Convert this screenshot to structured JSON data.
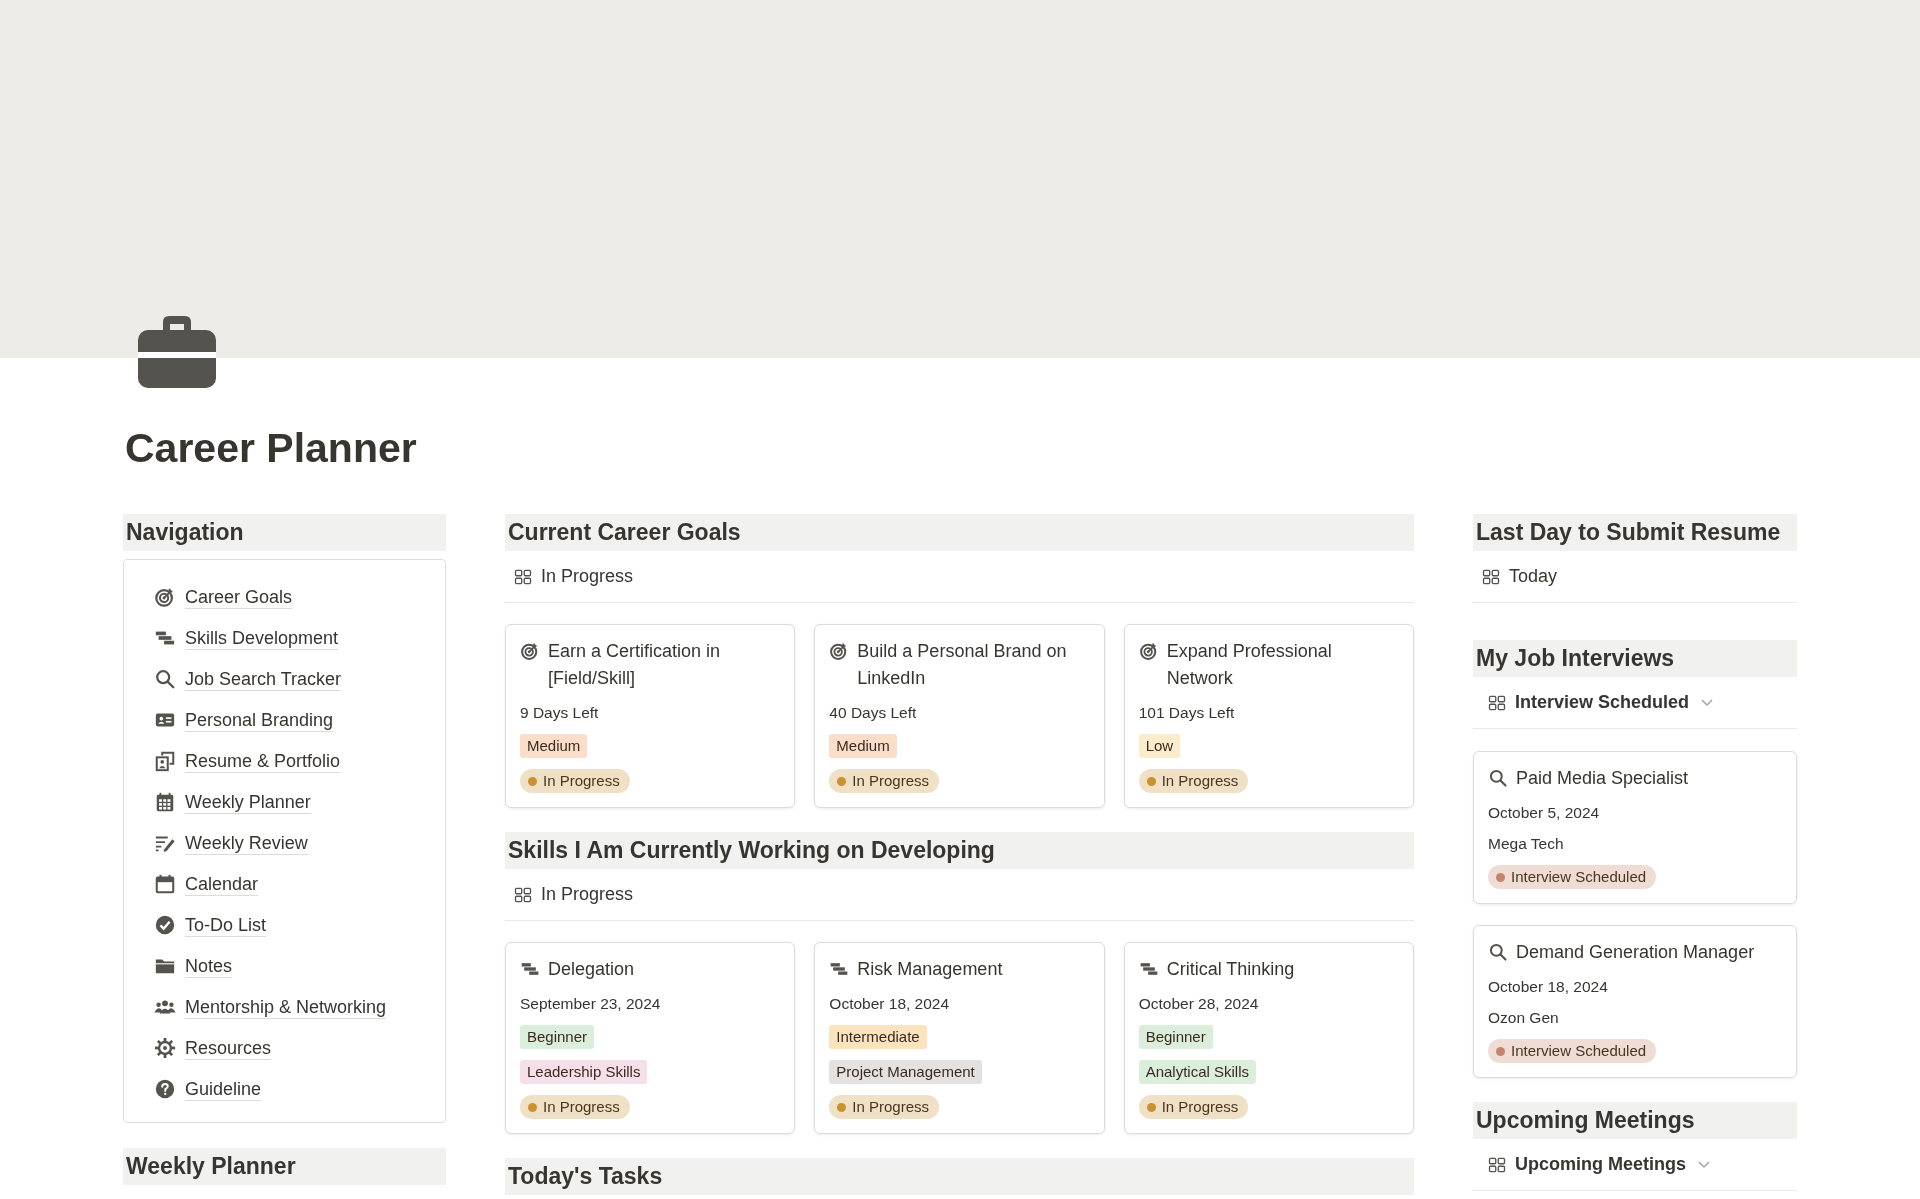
{
  "page": {
    "title": "Career Planner"
  },
  "navigation": {
    "title": "Navigation",
    "items": [
      {
        "kind": "target",
        "label": "Career Goals"
      },
      {
        "kind": "steps",
        "label": "Skills Development"
      },
      {
        "kind": "search",
        "label": "Job Search Tracker"
      },
      {
        "kind": "idcard",
        "label": "Personal Branding"
      },
      {
        "kind": "portfolio",
        "label": "Resume & Portfolio"
      },
      {
        "kind": "grid-calendar",
        "label": "Weekly Planner"
      },
      {
        "kind": "write",
        "label": "Weekly Review"
      },
      {
        "kind": "calendar",
        "label": "Calendar"
      },
      {
        "kind": "check",
        "label": "To-Do List"
      },
      {
        "kind": "folder",
        "label": "Notes"
      },
      {
        "kind": "people",
        "label": "Mentorship & Networking"
      },
      {
        "kind": "gear",
        "label": "Resources"
      },
      {
        "kind": "help",
        "label": "Guideline"
      }
    ]
  },
  "weekly_planner": {
    "title": "Weekly Planner"
  },
  "career_goals": {
    "title": "Current Career Goals",
    "view": "In Progress",
    "cards": [
      {
        "title": "Earn a Certification in [Field/Skill]",
        "meta": [
          "9 Days Left"
        ],
        "tags": [
          {
            "text": "Medium",
            "color": "#fadec9"
          }
        ],
        "status": {
          "text": "In Progress",
          "color": "#cb912f"
        }
      },
      {
        "title": "Build a Personal Brand on LinkedIn",
        "meta": [
          "40 Days Left"
        ],
        "tags": [
          {
            "text": "Medium",
            "color": "#fadec9"
          }
        ],
        "status": {
          "text": "In Progress",
          "color": "#cb912f"
        }
      },
      {
        "title": "Expand Professional Network",
        "meta": [
          "101 Days Left"
        ],
        "tags": [
          {
            "text": "Low",
            "color": "#fbeccc"
          }
        ],
        "status": {
          "text": "In Progress",
          "color": "#cb912f"
        }
      }
    ]
  },
  "skills": {
    "title": "Skills I Am Currently Working on Developing",
    "view": "In Progress",
    "cards": [
      {
        "title": "Delegation",
        "meta": [
          "September 23, 2024"
        ],
        "tags": [
          {
            "text": "Beginner",
            "color": "#dbeddb"
          },
          {
            "text": "Leadership Skills",
            "color": "#f5e0e9"
          }
        ],
        "status": {
          "text": "In Progress",
          "color": "#cb912f"
        }
      },
      {
        "title": "Risk Management",
        "meta": [
          "October 18, 2024"
        ],
        "tags": [
          {
            "text": "Intermediate",
            "color": "#fbe4bd"
          },
          {
            "text": "Project Management",
            "color": "#e3e2e0"
          }
        ],
        "status": {
          "text": "In Progress",
          "color": "#cb912f"
        }
      },
      {
        "title": "Critical Thinking",
        "meta": [
          "October 28, 2024"
        ],
        "tags": [
          {
            "text": "Beginner",
            "color": "#dbeddb"
          },
          {
            "text": "Analytical Skills",
            "color": "#dbeddb"
          }
        ],
        "status": {
          "text": "In Progress",
          "color": "#cb912f"
        }
      }
    ]
  },
  "todays_tasks": {
    "title": "Today's Tasks"
  },
  "resume_deadline": {
    "title": "Last Day to Submit Resume",
    "view": "Today"
  },
  "interviews": {
    "title": "My Job Interviews",
    "view": "Interview Scheduled",
    "cards": [
      {
        "title": "Paid Media Specialist",
        "meta": [
          "October 5, 2024",
          "Mega Tech"
        ],
        "status": {
          "text": "Interview Scheduled",
          "color": "#c4836a"
        }
      },
      {
        "title": "Demand Generation Manager",
        "meta": [
          "October 18, 2024",
          "Ozon Gen"
        ],
        "status": {
          "text": "Interview Scheduled",
          "color": "#c4836a"
        }
      }
    ]
  },
  "upcoming_meetings": {
    "title": "Upcoming Meetings",
    "view": "Upcoming Meetings"
  }
}
